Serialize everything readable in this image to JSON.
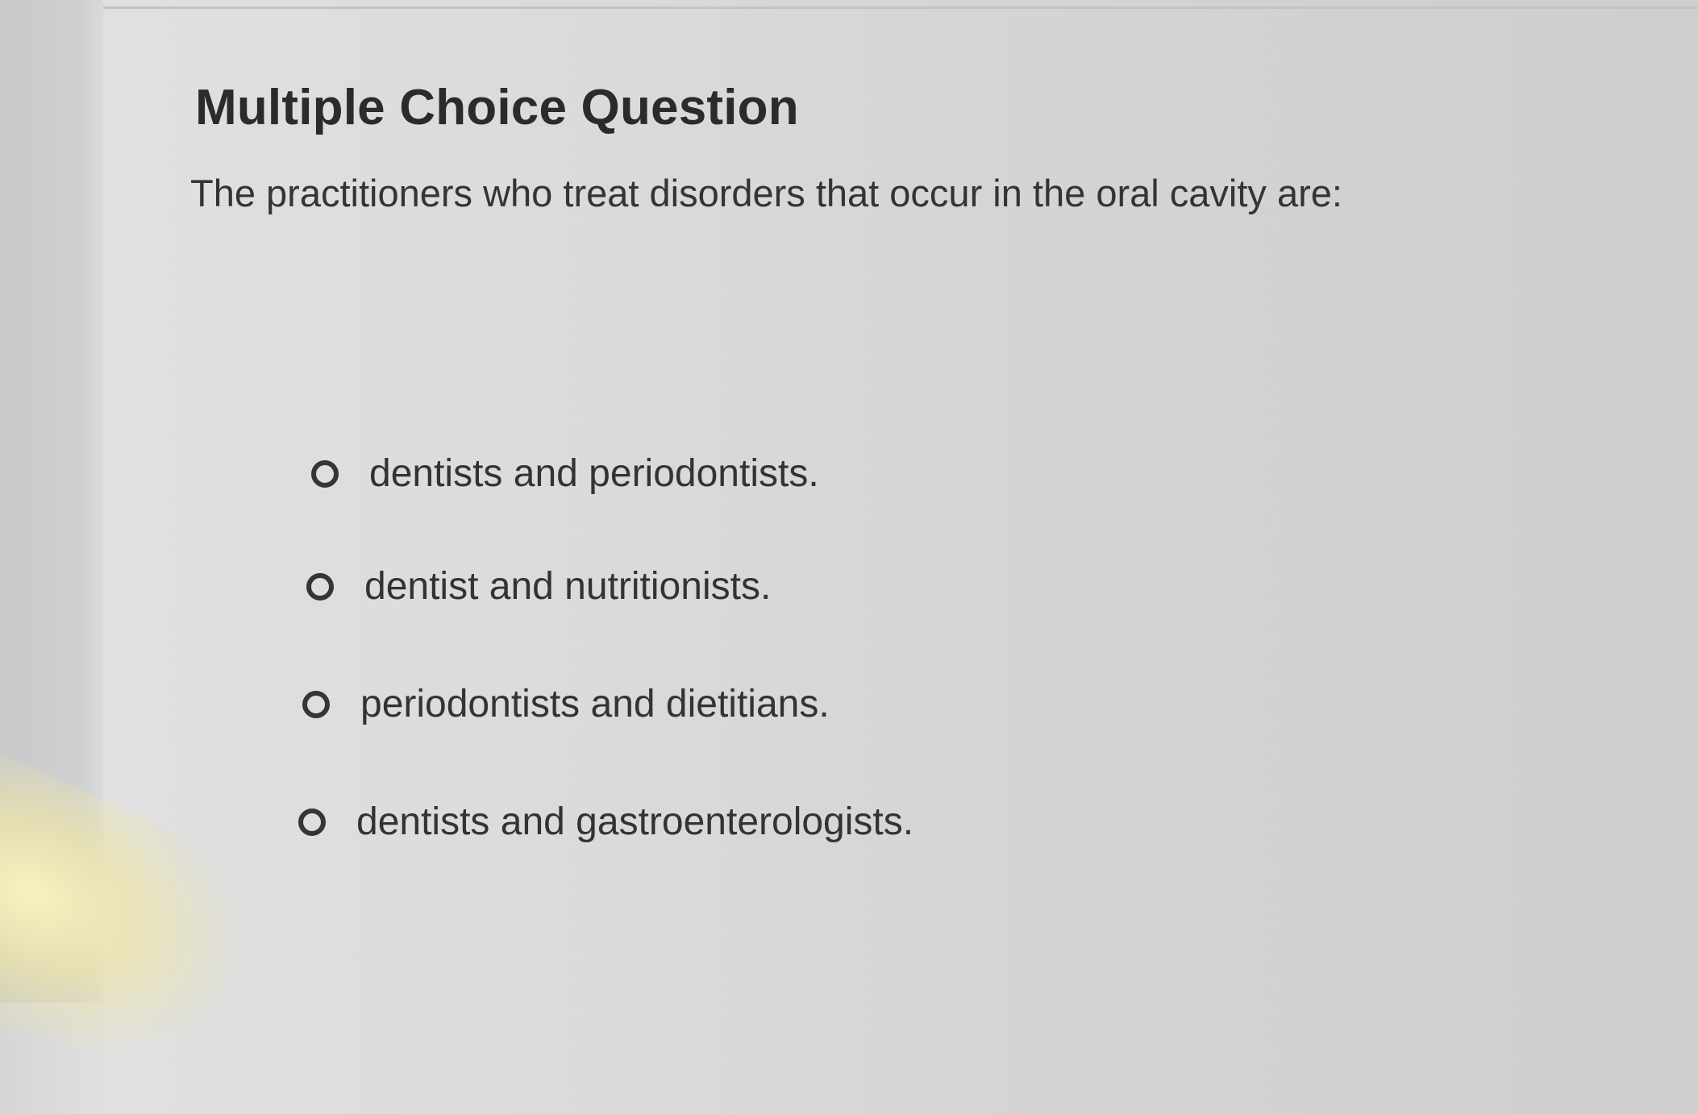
{
  "question": {
    "heading": "Multiple Choice Question",
    "prompt": "The practitioners who treat disorders that occur in the oral cavity are:",
    "options": [
      {
        "label": "dentists and periodontists.",
        "selected": false
      },
      {
        "label": "dentist and nutritionists.",
        "selected": false
      },
      {
        "label": "periodontists and dietitians.",
        "selected": false
      },
      {
        "label": "dentists and gastroenterologists.",
        "selected": false
      }
    ]
  },
  "icons": {
    "radio": "radio-button-icon"
  },
  "colors": {
    "text": "#2f2f2f",
    "background": "#d9dada"
  }
}
